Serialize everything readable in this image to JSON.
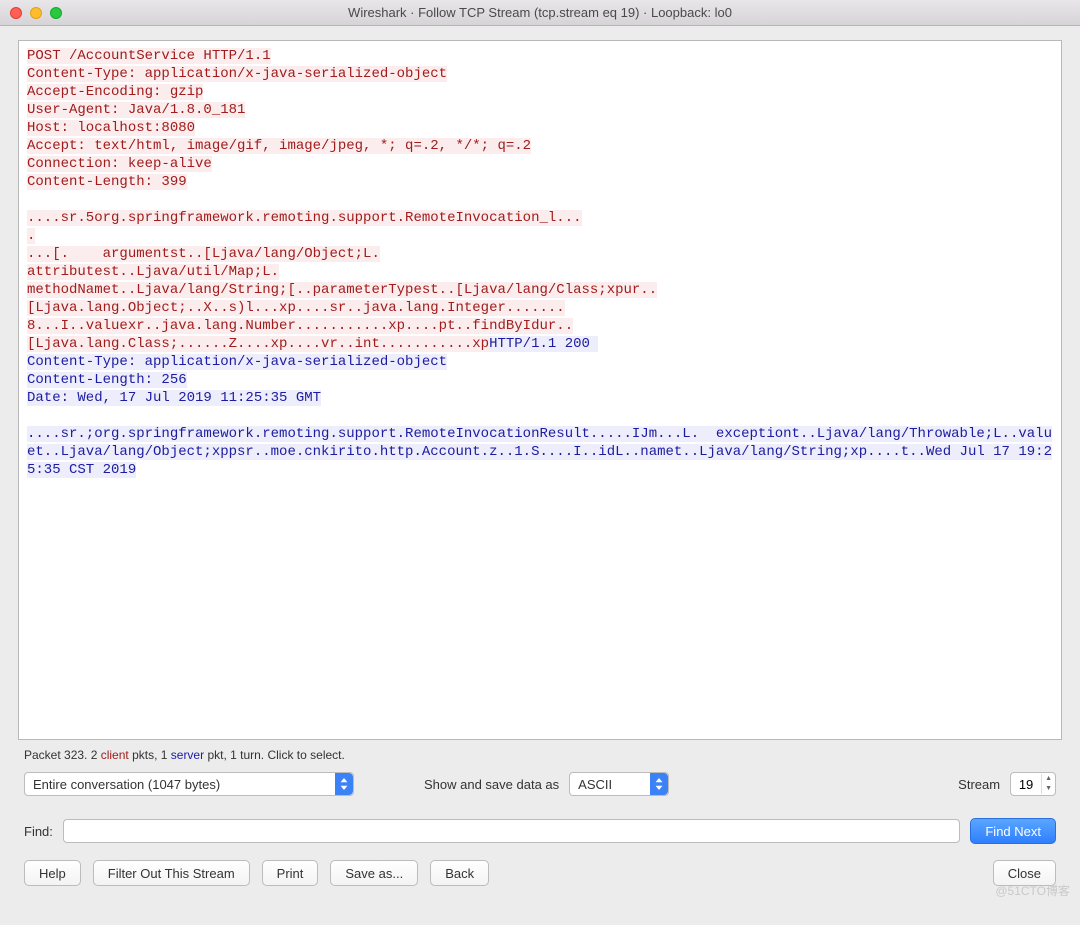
{
  "window": {
    "title": "Wireshark · Follow TCP Stream (tcp.stream eq 19) · Loopback: lo0"
  },
  "stream": {
    "request": "POST /AccountService HTTP/1.1\nContent-Type: application/x-java-serialized-object\nAccept-Encoding: gzip\nUser-Agent: Java/1.8.0_181\nHost: localhost:8080\nAccept: text/html, image/gif, image/jpeg, *; q=.2, */*; q=.2\nConnection: keep-alive\nContent-Length: 399\n\n....sr.5org.springframework.remoting.support.RemoteInvocation_l...\n.\n...[.    argumentst..[Ljava/lang/Object;L.\nattributest..Ljava/util/Map;L.\nmethodNamet..Ljava/lang/String;[..parameterTypest..[Ljava/lang/Class;xpur..\n[Ljava.lang.Object;..X..s)l...xp....sr..java.lang.Integer.......\n8...I..valuexr..java.lang.Number...........xp....pt..findByIdur..\n[Ljava.lang.Class;......Z....xp....vr..int...........xp",
    "response": "HTTP/1.1 200 \nContent-Type: application/x-java-serialized-object\nContent-Length: 256\nDate: Wed, 17 Jul 2019 11:25:35 GMT\n\n....sr.;org.springframework.remoting.support.RemoteInvocationResult.....IJm...L.  exceptiont..Ljava/lang/Throwable;L..valuet..Ljava/lang/Object;xppsr..moe.cnkirito.http.Account.z..1.S....I..idL..namet..Ljava/lang/String;xp....t..Wed Jul 17 19:25:35 CST 2019"
  },
  "status": {
    "prefix": "Packet 323. 2 ",
    "client_word": "client",
    "mid": " pkts, 1 ",
    "server_word": "server",
    "suffix": " pkt, 1 turn. Click to select."
  },
  "controls": {
    "conversation_select": "Entire conversation (1047 bytes)",
    "show_save_label": "Show and save data as",
    "format_select": "ASCII",
    "stream_label": "Stream",
    "stream_value": "19",
    "find_label": "Find:",
    "find_value": "",
    "find_next": "Find Next"
  },
  "buttons": {
    "help": "Help",
    "filter_out": "Filter Out This Stream",
    "print": "Print",
    "save_as": "Save as...",
    "back": "Back",
    "close": "Close"
  },
  "watermark": "@51CTO博客"
}
